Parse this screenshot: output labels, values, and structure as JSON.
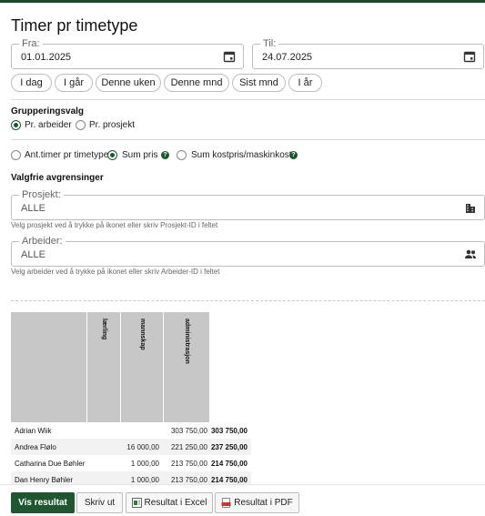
{
  "title": "Timer pr timetype",
  "date_from": {
    "label": "Fra:",
    "value": "01.01.2025"
  },
  "date_to": {
    "label": "Til:",
    "value": "24.07.2025"
  },
  "quick_ranges": [
    "I dag",
    "I går",
    "Denne uken",
    "Denne mnd",
    "Sist mnd",
    "I år"
  ],
  "grouping": {
    "title": "Grupperingsvalg",
    "options": [
      {
        "label": "Pr. arbeider",
        "selected": true
      },
      {
        "label": "Pr. prosjekt",
        "selected": false
      }
    ]
  },
  "measure": {
    "options": [
      {
        "label": "Ant.timer pr timetype",
        "selected": false,
        "help": false
      },
      {
        "label": "Sum pris",
        "selected": true,
        "help": true
      },
      {
        "label": "Sum kostpris/maskinkost",
        "selected": false,
        "help": true
      }
    ]
  },
  "filters": {
    "title": "Valgfrie avgrensinger",
    "project": {
      "label": "Prosjekt:",
      "value": "ALLE",
      "hint": "Velg prosjekt ved å trykke på ikonet eller skriv Prosjekt-ID i feltet"
    },
    "worker": {
      "label": "Arbeider:",
      "value": "ALLE",
      "hint": "Velg arbeider ved å trykke på ikonet eller skriv Arbeider-ID i feltet"
    }
  },
  "table": {
    "columns": [
      "lærling",
      "mannskap",
      "administrasjon"
    ],
    "rows": [
      {
        "name": "Adrian Wiik",
        "values": [
          "",
          "",
          "303 750,00"
        ],
        "total": "303 750,00"
      },
      {
        "name": "Andrea Flølo",
        "values": [
          "",
          "16 000,00",
          "221 250,00"
        ],
        "total": "237 250,00"
      },
      {
        "name": "Catharina Due Bøhler",
        "values": [
          "",
          "1 000,00",
          "213 750,00"
        ],
        "total": "214 750,00"
      },
      {
        "name": "Dan Henry Bøhler",
        "values": [
          "",
          "1 000,00",
          "213 750,00"
        ],
        "total": "214 750,00"
      }
    ]
  },
  "footer": {
    "show": "Vis resultat",
    "print": "Skriv ut",
    "excel": "Resultat i Excel",
    "pdf": "Resultat i PDF"
  },
  "colors": {
    "accent": "#1f5632",
    "header_bg": "#c7c7c7"
  }
}
